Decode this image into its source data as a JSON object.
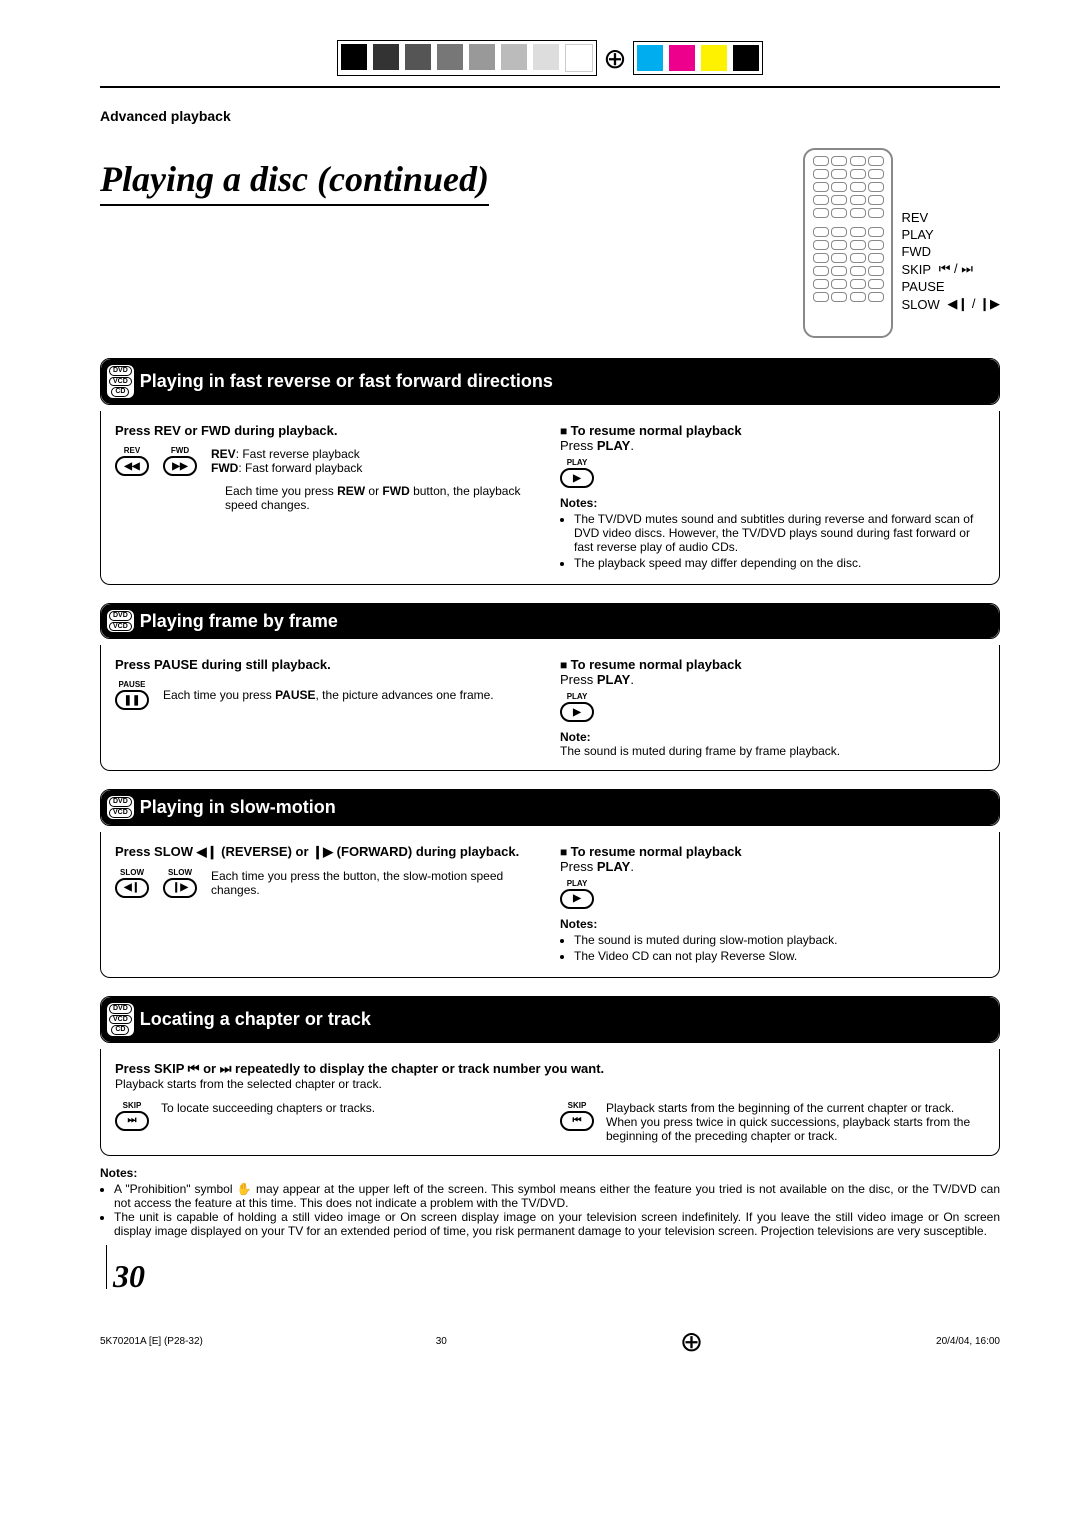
{
  "header": {
    "section_label": "Advanced playback",
    "main_title": "Playing a disc (continued)"
  },
  "remote_labels": {
    "rev": "REV",
    "play": "PLAY",
    "fwd": "FWD",
    "skip": "SKIP",
    "skip_icons": "⏮ / ⏭",
    "pause": "PAUSE",
    "slow": "SLOW",
    "slow_icons": "◀❙ / ❙▶"
  },
  "sections": {
    "fastplay": {
      "title": "Playing in fast reverse or fast forward directions",
      "badges": [
        "DVD",
        "VCD",
        "CD"
      ],
      "left_instruction": "Press REV or FWD during playback.",
      "rev_label": "REV",
      "fwd_label": "FWD",
      "rev_desc_bold": "REV",
      "rev_desc": ":  Fast reverse playback",
      "fwd_desc_bold": "FWD",
      "fwd_desc": ": Fast forward playback",
      "speed_line_pre": "Each time you press ",
      "speed_bold1": "REW",
      "speed_mid": " or ",
      "speed_bold2": "FWD",
      "speed_line_post": " button, the playback speed changes.",
      "resume_heading": "To resume normal playback",
      "resume_press": "Press ",
      "resume_play": "PLAY",
      "play_btn_label": "PLAY",
      "notes_label": "Notes:",
      "notes": [
        "The TV/DVD mutes sound and subtitles during reverse and forward scan of DVD video discs. However, the TV/DVD plays sound during fast forward or fast reverse play of audio CDs.",
        "The playback speed may differ depending on the disc."
      ]
    },
    "frame": {
      "title": "Playing frame by frame",
      "badges": [
        "DVD",
        "VCD"
      ],
      "left_instruction": "Press PAUSE during still playback.",
      "pause_label": "PAUSE",
      "desc_pre": "Each time you press ",
      "desc_bold": "PAUSE",
      "desc_post": ", the picture advances one frame.",
      "resume_heading": "To resume normal playback",
      "resume_press": "Press ",
      "resume_play": "PLAY",
      "play_btn_label": "PLAY",
      "note_label": "Note:",
      "note": "The sound is muted during frame by frame playback."
    },
    "slow": {
      "title": "Playing in slow-motion",
      "badges": [
        "DVD",
        "VCD"
      ],
      "left_instruction_pre": "Press SLOW ",
      "left_instruction_rev": "◀❙ (REVERSE)",
      "left_instruction_mid": " or ",
      "left_instruction_fwd": "❙▶ (FORWARD)",
      "left_instruction_post": " during playback.",
      "slow_label": "SLOW",
      "desc": "Each time you press the button, the slow-motion speed changes.",
      "resume_heading": "To resume normal playback",
      "resume_press": "Press ",
      "resume_play": "PLAY",
      "play_btn_label": "PLAY",
      "notes_label": "Notes:",
      "notes": [
        "The sound is muted during slow-motion playback.",
        "The Video CD can not play Reverse Slow."
      ]
    },
    "locate": {
      "title": "Locating a chapter or track",
      "badges": [
        "DVD",
        "VCD",
        "CD"
      ],
      "instruction_pre": "Press SKIP ",
      "instruction_b1": "⏮",
      "instruction_mid1": " or ",
      "instruction_b2": "⏭",
      "instruction_post": " repeatedly to display the chapter or track number you want.",
      "sub": "Playback starts from the selected chapter or track.",
      "skip_label": "SKIP",
      "fwd_desc": "To locate succeeding chapters or tracks.",
      "back_desc": "Playback starts from the beginning of the current chapter or track.\nWhen you press twice in quick successions, playback starts from the beginning of the preceding chapter or track."
    }
  },
  "footer_notes": {
    "label": "Notes:",
    "items": [
      "A \"Prohibition\" symbol ✋ may appear at the upper left of the screen. This symbol means either the feature you tried is not available on the disc, or the TV/DVD can not access the feature at this time. This does not indicate a problem with the TV/DVD.",
      "The unit is capable of holding a still video image or On screen display image on your television screen indefinitely. If you leave the still video image or On screen display image displayed on your TV for an extended period of time, you risk permanent damage to your television screen.  Projection televisions are very susceptible."
    ]
  },
  "page_number": "30",
  "print_footer": {
    "left": "5K70201A [E] (P28-32)",
    "mid": "30",
    "right": "20/4/04, 16:00"
  },
  "colors": {
    "swatches": [
      "#000",
      "#333",
      "#555",
      "#777",
      "#999",
      "#bbb",
      "#ddd",
      "#fff",
      "#00aeef",
      "#ec008c",
      "#fff200",
      "#000"
    ]
  }
}
